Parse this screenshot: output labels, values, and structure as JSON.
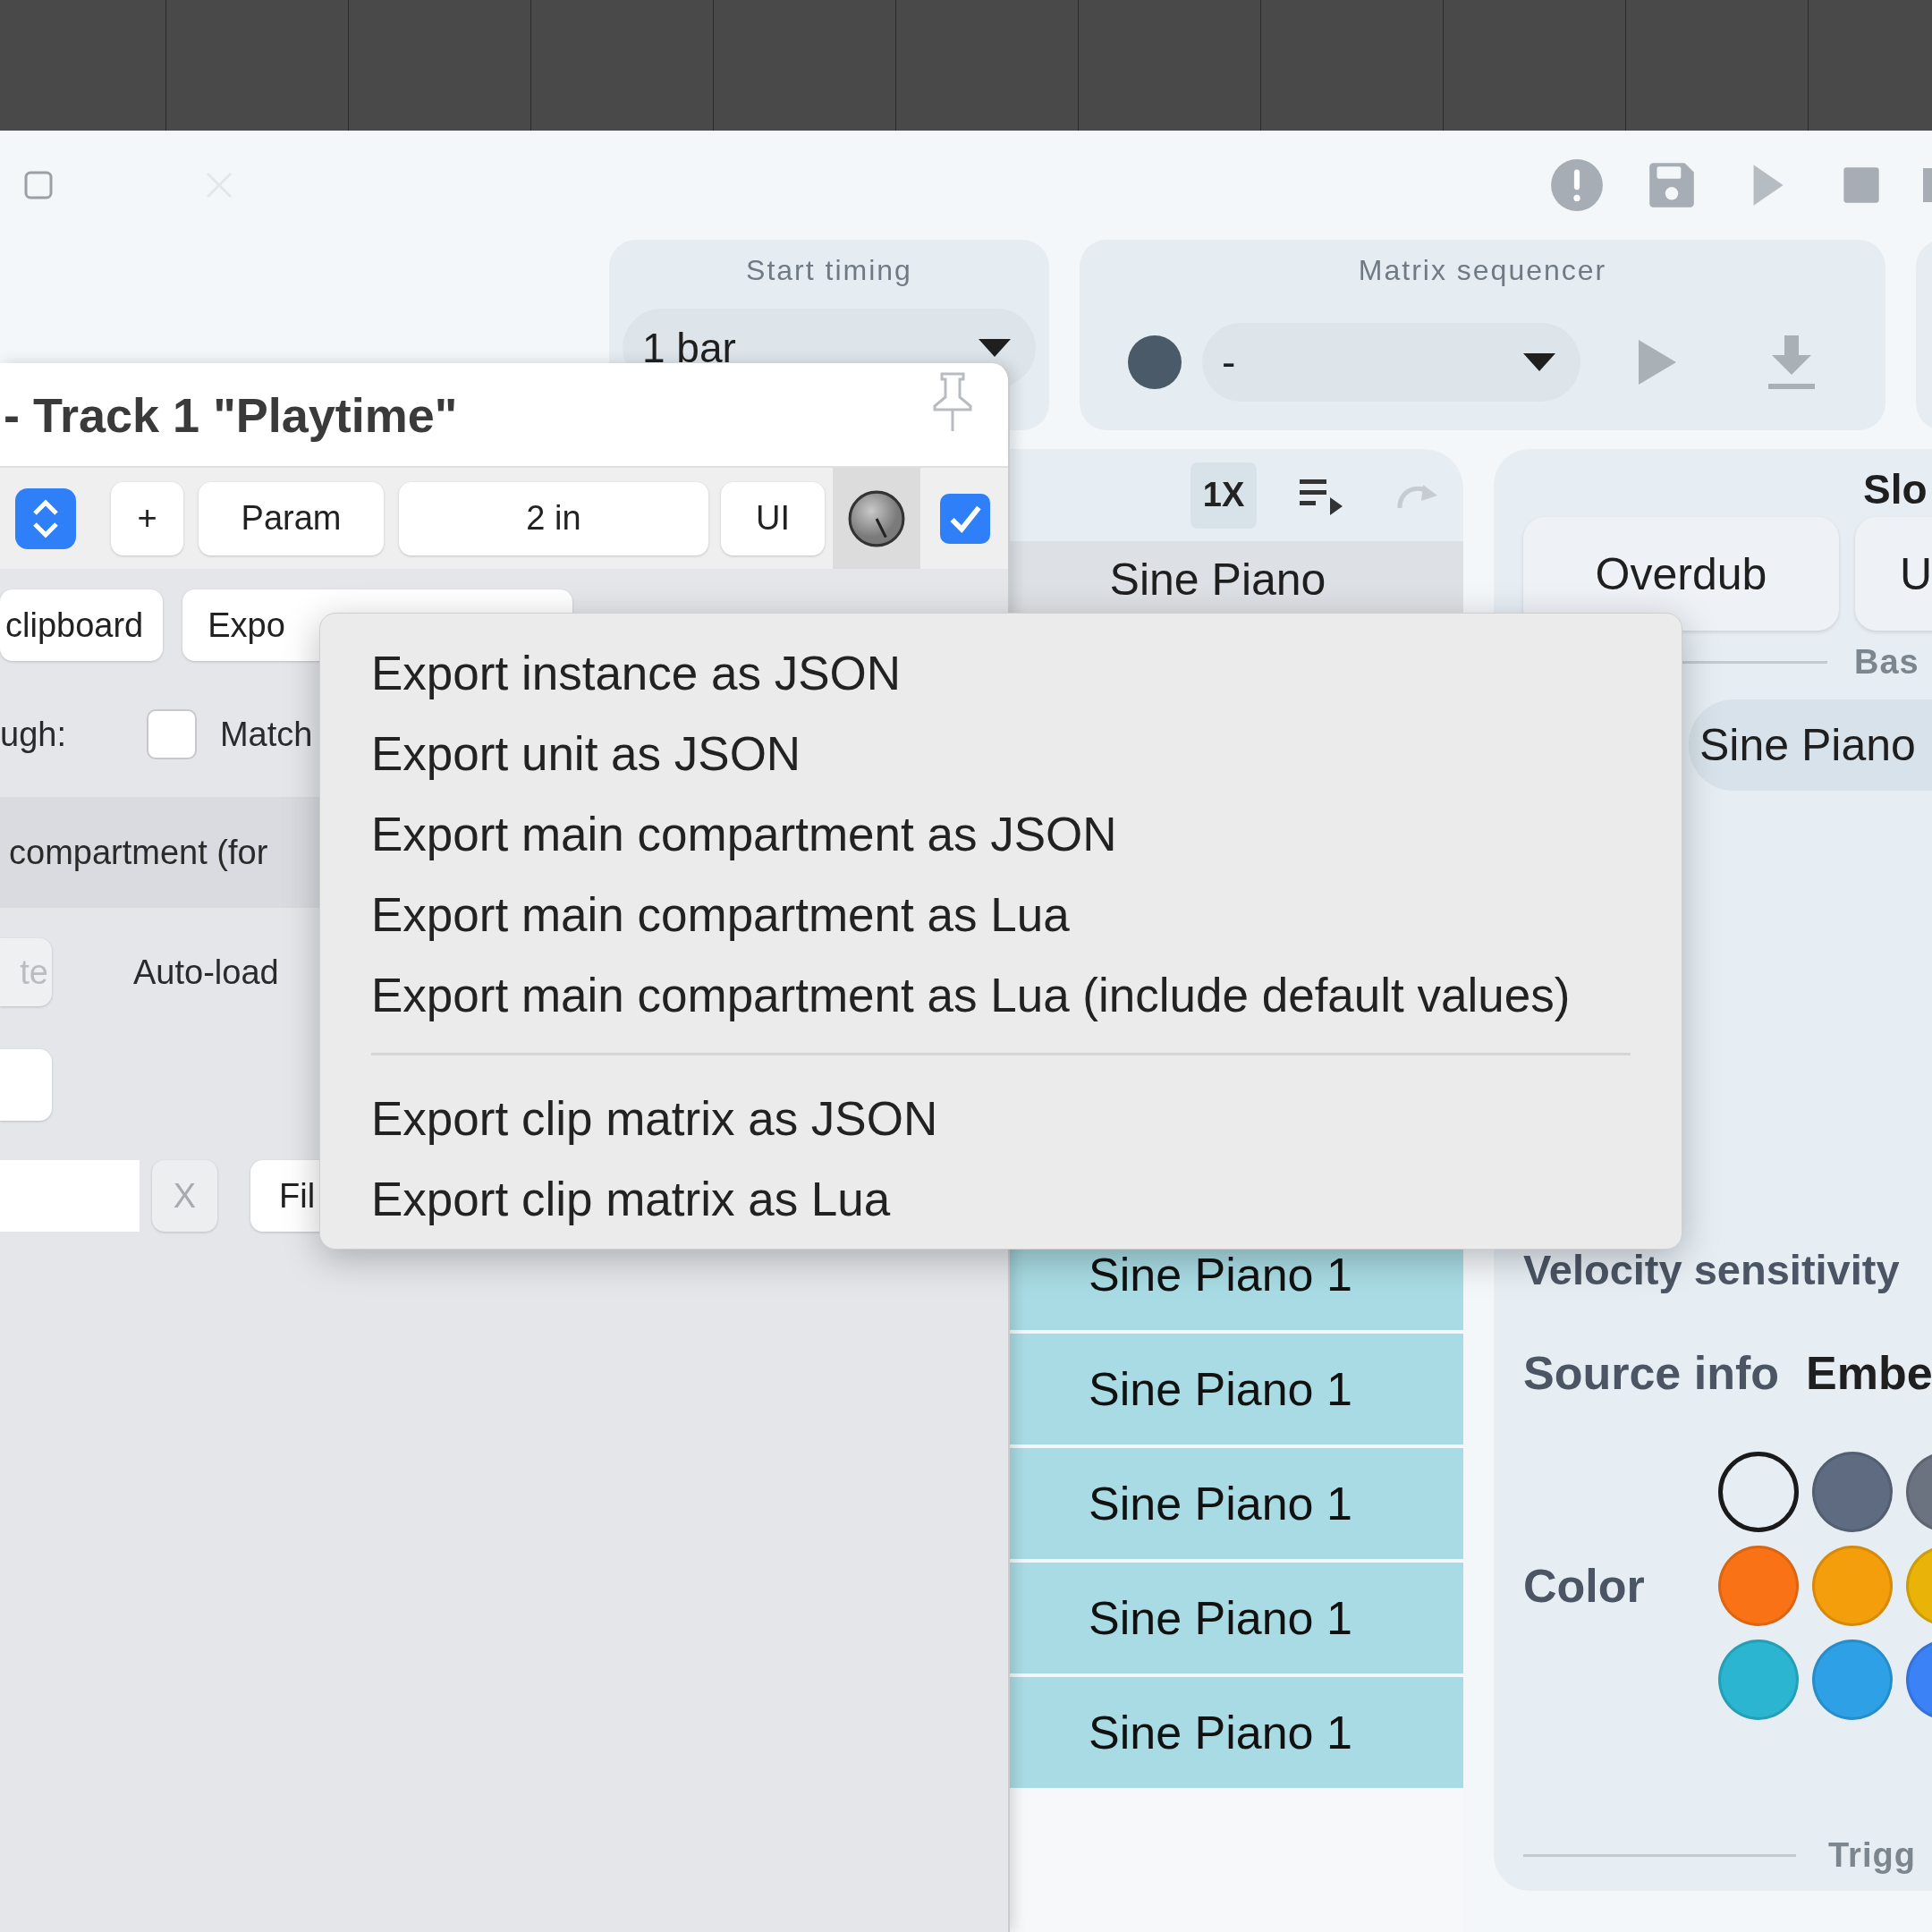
{
  "start_timing": {
    "label": "Start timing",
    "value": "1 bar"
  },
  "matrix_sequencer": {
    "label": "Matrix sequencer",
    "value": "-"
  },
  "clip_column": {
    "zoom_button": "1X",
    "title": "Sine Piano",
    "clips": [
      "Sine Piano 1",
      "Sine Piano 1",
      "Sine Piano 1",
      "Sine Piano 1",
      "Sine Piano 1"
    ]
  },
  "slot_panel": {
    "title": "Slo",
    "buttons": [
      "Overdub",
      "U"
    ],
    "section_label": "Bas",
    "clip_name": "Sine Piano",
    "velocity_label": "Velocity sensitivity",
    "source_info": {
      "label": "Source info",
      "value": "Embe"
    },
    "color": {
      "label": "Color",
      "swatches": [
        {
          "kind": "none",
          "selected": true
        },
        {
          "kind": "color",
          "color": "#5f6b80",
          "selected": false
        },
        {
          "kind": "color",
          "color": "#6b7280",
          "selected": false
        },
        {
          "kind": "color",
          "color": "#f97316",
          "selected": false
        },
        {
          "kind": "color",
          "color": "#f59e0b",
          "selected": false
        },
        {
          "kind": "color",
          "color": "#eab308",
          "selected": false
        },
        {
          "kind": "color",
          "color": "#2bb5d0",
          "selected": false
        },
        {
          "kind": "color",
          "color": "#2ea0e6",
          "selected": false
        },
        {
          "kind": "color",
          "color": "#3b82f6",
          "selected": false
        }
      ]
    },
    "trigger_label": "Trigg"
  },
  "floating_window": {
    "title": "- Track 1 \"Playtime\"",
    "toolbar": {
      "add": "+",
      "param": "Param",
      "input": "2 in",
      "ui": "UI",
      "enabled": true
    },
    "buttons": [
      "clipboard",
      "Expo"
    ],
    "passthrough": {
      "label": "ugh:",
      "checked": false,
      "match_label": "Match"
    },
    "compartment_label": "compartment (for",
    "auto_load": {
      "button": "te",
      "label": "Auto-load"
    },
    "filter": {
      "clear": "X",
      "file": "Fil"
    }
  },
  "context_menu": {
    "groups": [
      [
        "Export instance as JSON",
        "Export unit as JSON",
        "Export main compartment as JSON",
        "Export main compartment as Lua",
        "Export main compartment as Lua (include default values)"
      ],
      [
        "Export clip matrix as JSON",
        "Export clip matrix as Lua"
      ]
    ]
  }
}
